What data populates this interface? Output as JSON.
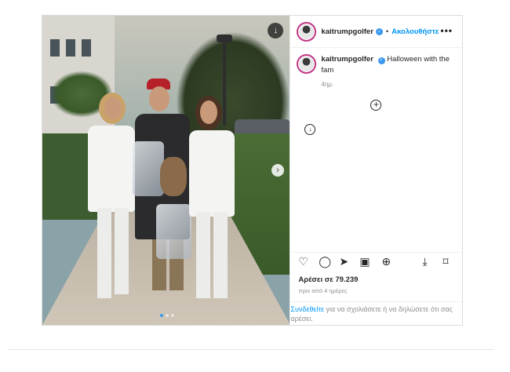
{
  "post": {
    "username": "kaitrumpgolfer",
    "follow_label": "Ακολουθήστε",
    "separator": "•",
    "more_label": "•••",
    "caption": "Halloween with the fam",
    "caption_time": "4ημ.",
    "likes_text": "Αρέσει σε 79.239",
    "date_text": "πριν από 4 ημέρες",
    "login_link": "Συνδεθείτε",
    "login_rest": "για να σχολιάσετε ή να δηλώσετε ότι σας αρέσει."
  },
  "icons": {
    "download": "↓",
    "next": "›",
    "plus": "+",
    "verified": "✓",
    "like": "♡",
    "comment": "◯",
    "share": "➤",
    "gift": "▣",
    "remix": "⊕",
    "save_download": "⤓",
    "bookmark": "⌑"
  },
  "carousel": {
    "slides": 3,
    "active_slide": 1
  },
  "colors": {
    "accent": "#0095f6",
    "verified": "#3897f0",
    "cap": "#b5202a"
  }
}
